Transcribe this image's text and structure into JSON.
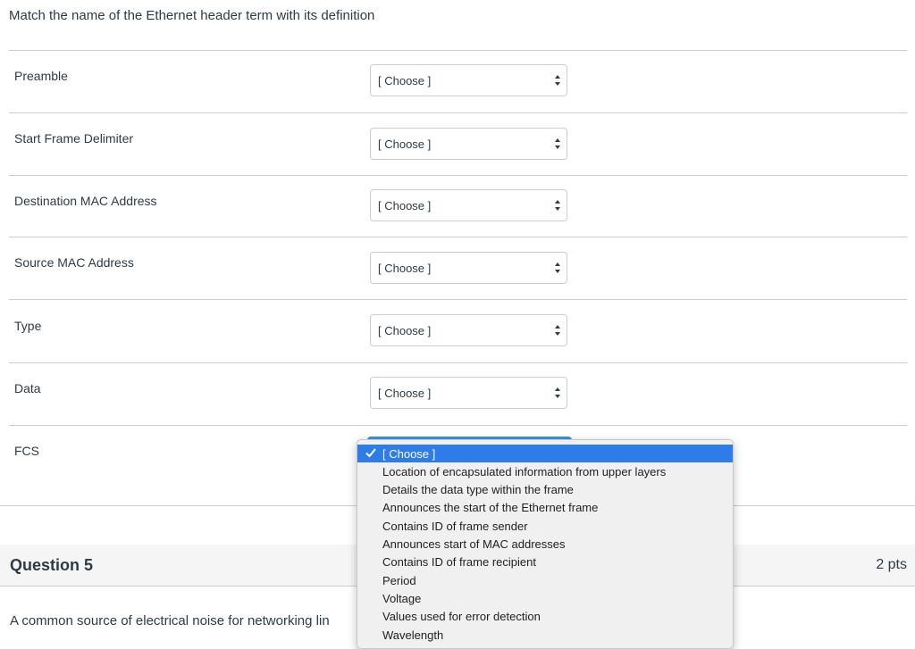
{
  "question": {
    "prompt": "Match the name of the Ethernet header term with its definition",
    "rows": [
      {
        "label": "Preamble",
        "value": "[ Choose ]"
      },
      {
        "label": "Start Frame Delimiter",
        "value": "[ Choose ]"
      },
      {
        "label": "Destination MAC Address",
        "value": "[ Choose ]"
      },
      {
        "label": "Source MAC Address",
        "value": "[ Choose ]"
      },
      {
        "label": "Type",
        "value": "[ Choose ]"
      },
      {
        "label": "Data",
        "value": "[ Choose ]"
      },
      {
        "label": "FCS",
        "value": "[ Choose ]"
      }
    ]
  },
  "dropdown": {
    "options": [
      "[ Choose ]",
      "Location of encapsulated information from upper layers",
      "Details the data type within the frame",
      "Announces the start of the Ethernet frame",
      "Contains ID of frame sender",
      "Announces start of MAC addresses",
      "Contains ID of frame recipient",
      "Period",
      "Voltage",
      "Values used for error detection",
      "Wavelength"
    ],
    "selected_index": 0
  },
  "next_question": {
    "title": "Question 5",
    "points": "2 pts",
    "text": "A common source of electrical noise for networking lin"
  },
  "colors": {
    "highlight": "#2e7ce8",
    "text": "#2d3b45",
    "rule": "#c7cdd1"
  }
}
